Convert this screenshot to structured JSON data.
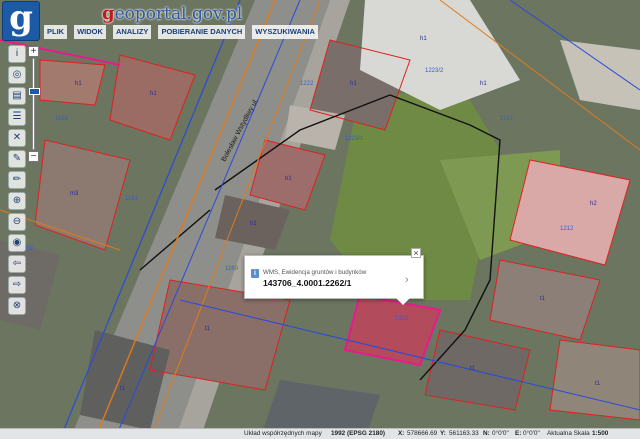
{
  "header": {
    "logo_letter": "g",
    "brand_prefix": "g",
    "brand_rest": "eoportal.gov.pl",
    "accent_red": "#c8151b",
    "accent_blue": "#2a57a0"
  },
  "menu": [
    "PLIK",
    "WIDOK",
    "ANALIZY",
    "POBIERANIE DANYCH",
    "WYSZUKIWANIA"
  ],
  "toolbar": {
    "icons": [
      "info-icon",
      "layers-icon",
      "legend-icon",
      "list-icon",
      "delete-icon",
      "measure-icon",
      "draw-icon",
      "zoom-in-icon",
      "zoom-out-icon",
      "globe-icon",
      "pan-left-icon",
      "pan-right-icon",
      "reset-icon"
    ],
    "glyphs": [
      "i",
      "◎",
      "▤",
      "☰",
      "✕",
      "✎",
      "✏",
      "⊕",
      "⊖",
      "◉",
      "⇦",
      "⇨",
      "⊗"
    ]
  },
  "zoom_control": {
    "plus": "+",
    "minus": "−",
    "level_fraction": 0.35
  },
  "map": {
    "street_label": "Bolesław Wstydliwy ul.",
    "parcel_labels": [
      "h1",
      "h1",
      "h1",
      "h1",
      "h1",
      "h2",
      "m3",
      "t1",
      "t1",
      "t1",
      "t1",
      "h1",
      "h1",
      "h1",
      "t1"
    ],
    "parcel_numbers": [
      "1223/2",
      "1223/1",
      "1212",
      "1161",
      "1186",
      "1221",
      "1222",
      "1213",
      "1158",
      "1160"
    ]
  },
  "popup": {
    "layer_title": "WMS, Ewidencja gruntów i budynków",
    "parcel_id": "143706_4.0001.2262/1",
    "close": "×",
    "chevron": "›",
    "info": "i"
  },
  "status": {
    "crs_label": "Układ współrzędnych mapy",
    "crs_value": "1992 (EPSG 2180)",
    "x_label": "X:",
    "x_value": "578666.69",
    "y_label": "Y:",
    "y_value": "561163.33",
    "n_label": "N:",
    "n_value": "0°0'0\"",
    "e_label": "E:",
    "e_value": "0°0'0\"",
    "scale_label": "Aktualna Skala",
    "scale_value": "1:500"
  }
}
